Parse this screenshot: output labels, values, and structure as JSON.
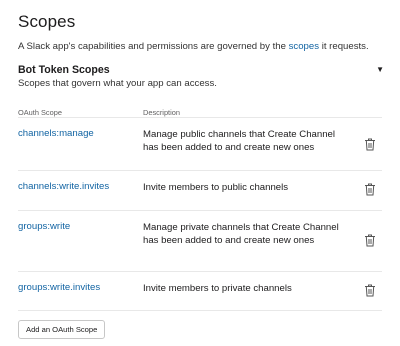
{
  "page": {
    "title": "Scopes",
    "intro_before": "A Slack app's capabilities and permissions are governed by the ",
    "intro_link": "scopes",
    "intro_after": " it requests."
  },
  "section": {
    "title": "Bot Token Scopes",
    "subtitle": "Scopes that govern what your app can access."
  },
  "table": {
    "col_scope": "OAuth Scope",
    "col_description": "Description",
    "rows": [
      {
        "scope": "channels:manage",
        "description": "Manage public channels that Create Channel has been added to and create new ones"
      },
      {
        "scope": "channels:write.invites",
        "description": "Invite members to public channels"
      },
      {
        "scope": "groups:write",
        "description": "Manage private channels that Create Channel has been added to and create new ones"
      },
      {
        "scope": "groups:write.invites",
        "description": "Invite members to private channels"
      }
    ]
  },
  "actions": {
    "add_scope_label": "Add an OAuth Scope"
  },
  "icons": {
    "toggle": "caret-down-icon",
    "row_action": "trash-icon"
  },
  "colors": {
    "link": "#1264a3"
  }
}
